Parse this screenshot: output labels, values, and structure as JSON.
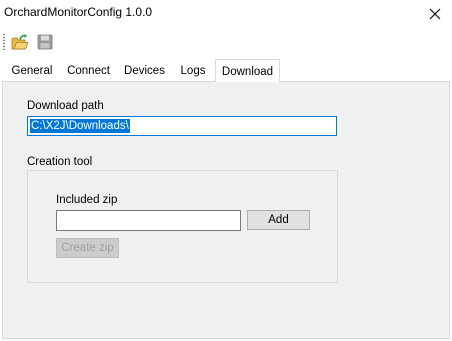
{
  "window": {
    "title": "OrchardMonitorConfig 1.0.0"
  },
  "toolbar": {
    "buttons": [
      {
        "icon": "open-folder-icon"
      },
      {
        "icon": "save-icon",
        "disabled": true
      }
    ]
  },
  "tabs": [
    {
      "label": "General",
      "active": false
    },
    {
      "label": "Connect",
      "active": false
    },
    {
      "label": "Devices",
      "active": false
    },
    {
      "label": "Logs",
      "active": false
    },
    {
      "label": "Download",
      "active": true
    }
  ],
  "download": {
    "path_label": "Download path",
    "path_value": "C:\\X2J\\Downloads\\",
    "creation_group_label": "Creation tool",
    "included_zip_label": "Included zip",
    "included_zip_value": "",
    "add_label": "Add",
    "create_zip_label": "Create zip"
  },
  "colors": {
    "accent": "#0078d7",
    "panel_bg": "#f0f0f0"
  }
}
